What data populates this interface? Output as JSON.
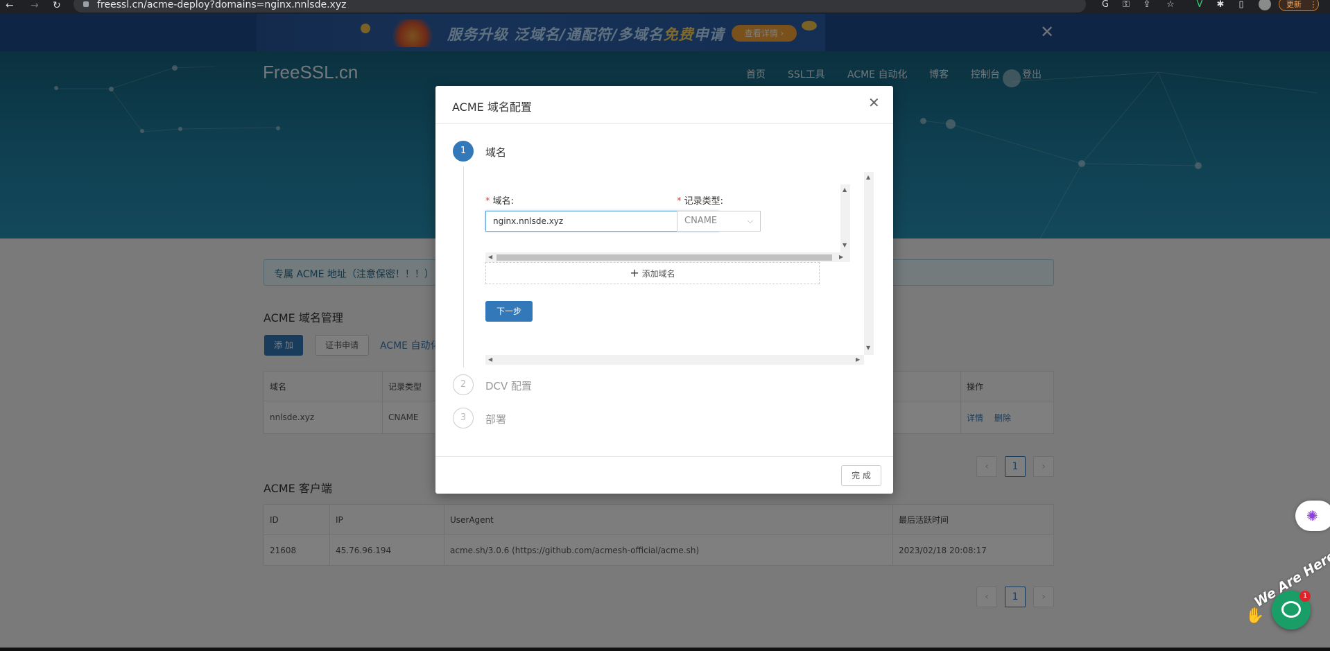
{
  "browser": {
    "url": "freessl.cn/acme-deploy?domains=nginx.nnlsde.xyz",
    "update_label": "更新",
    "menu_label": "⋮"
  },
  "promo": {
    "text_part1": "服务升级 泛域名/通配符/多域名",
    "text_highlight": "免费",
    "text_part2": "申请",
    "button_label": "查看详情 ›",
    "close_label": "✕"
  },
  "header": {
    "logo": "FreeSSL.cn",
    "nav": [
      "首页",
      "SSL工具",
      "ACME 自动化",
      "博客",
      "控制台",
      "登出"
    ]
  },
  "main": {
    "alert_text": "专属 ACME 地址（注意保密！！！）",
    "domain_section": {
      "title": "ACME 域名管理",
      "add_button": "添 加",
      "cert_button": "证书申请",
      "auto_link": "ACME 自动化",
      "columns": [
        "域名",
        "记录类型",
        "操作"
      ],
      "rows": [
        {
          "domain": "nnlsde.xyz",
          "record_type": "CNAME",
          "detail": "详情",
          "delete": "删除"
        }
      ],
      "pagination": {
        "prev": "‹",
        "page": "1",
        "next": "›"
      }
    },
    "client_section": {
      "title": "ACME 客户端",
      "columns": [
        "ID",
        "IP",
        "UserAgent",
        "最后活跃时间"
      ],
      "rows": [
        {
          "id": "21608",
          "ip": "45.76.96.194",
          "ua": "acme.sh/3.0.6 (https://github.com/acmesh-official/acme.sh)",
          "last_active": "2023/02/18 20:08:17"
        }
      ],
      "pagination": {
        "prev": "‹",
        "page": "1",
        "next": "›"
      }
    }
  },
  "modal": {
    "title": "ACME 域名配置",
    "close_label": "✕",
    "steps": [
      {
        "number": "1",
        "label": "域名",
        "active": true
      },
      {
        "number": "2",
        "label": "DCV 配置",
        "active": false
      },
      {
        "number": "3",
        "label": "部署",
        "active": false
      }
    ],
    "form": {
      "domain_label": "域名:",
      "domain_value": "nginx.nnlsde.xyz",
      "record_type_label": "记录类型:",
      "record_type_value": "CNAME",
      "add_domain_label": "添加域名",
      "next_button": "下一步"
    },
    "done_button": "完 成"
  },
  "widgets": {
    "we_are_here": "We Are Here!",
    "chat_badge": "1"
  }
}
